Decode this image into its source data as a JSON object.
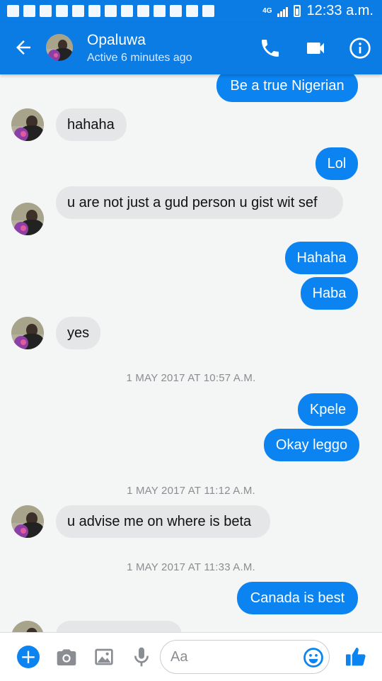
{
  "status_bar": {
    "network": "4G",
    "time": "12:33 a.m."
  },
  "header": {
    "contact_name": "Opaluwa",
    "contact_status": "Active 6 minutes ago",
    "icons": {
      "back": "back-arrow-icon",
      "call": "phone-icon",
      "video": "video-camera-icon",
      "info": "info-icon"
    }
  },
  "messages": [
    {
      "sender": "me",
      "text": "Be a true Nigerian"
    },
    {
      "sender": "contact",
      "text": "hahaha"
    },
    {
      "sender": "me",
      "text": "Lol"
    },
    {
      "sender": "contact",
      "text": "u are not just a gud person u gist wit sef"
    },
    {
      "sender": "me",
      "text": "Hahaha"
    },
    {
      "sender": "me",
      "text": "Haba"
    },
    {
      "sender": "contact",
      "text": "yes"
    },
    {
      "timestamp": "1 MAY 2017 AT 10:57 A.M."
    },
    {
      "sender": "me",
      "text": "Kpele"
    },
    {
      "sender": "me",
      "text": "Okay leggo"
    },
    {
      "timestamp": "1 MAY 2017 AT 11:12 A.M."
    },
    {
      "sender": "contact",
      "text": "u advise me on where is beta"
    },
    {
      "timestamp": "1 MAY 2017 AT 11:33 A.M."
    },
    {
      "sender": "me",
      "text": "Canada is best"
    }
  ],
  "composer": {
    "placeholder": "Aa",
    "icons": [
      "plus-icon",
      "camera-icon",
      "gallery-icon",
      "microphone-icon",
      "emoji-icon",
      "thumbs-up-icon"
    ]
  },
  "colors": {
    "brand": "#0c7ce5",
    "outgoing_bubble": "#0b84f2",
    "incoming_bubble": "#e5e6e8",
    "background": "#f4f5f5"
  }
}
